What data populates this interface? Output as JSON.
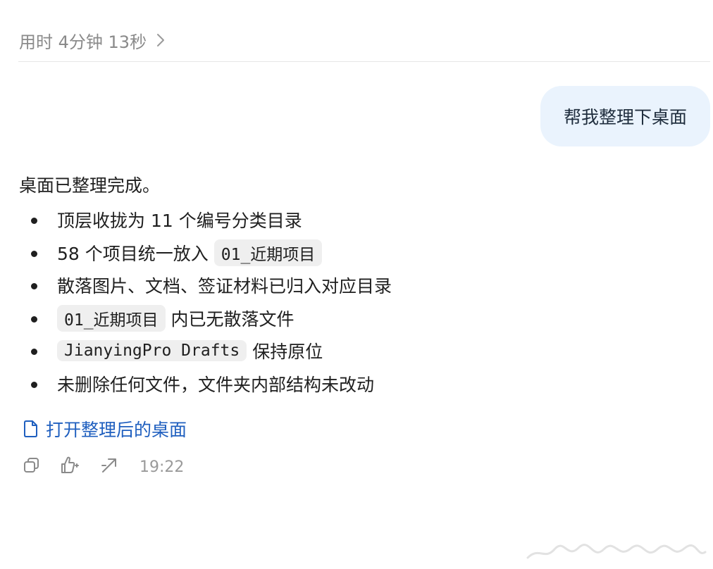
{
  "header": {
    "elapsed": "用时 4分钟 13秒"
  },
  "conversation": {
    "user_message": "帮我整理下桌面",
    "reply_title": "桌面已整理完成。",
    "bullets": {
      "b1": "顶层收拢为 11 个编号分类目录",
      "b2_text": "58 个项目统一放入",
      "b2_code": "01_近期项目",
      "b3": "散落图片、文档、签证材料已归入对应目录",
      "b4_code": "01_近期项目",
      "b4_text": "内已无散落文件",
      "b5_code": "JianyingPro Drafts",
      "b5_text": "保持原位",
      "b6": "未删除任何文件，文件夹内部结构未改动"
    },
    "open_link_label": "打开整理后的桌面",
    "timestamp": "19:22"
  },
  "icons": {
    "elapsed": "chevron-right-icon",
    "link": "document-icon",
    "actions": [
      "copy-icon",
      "thumbs-feedback-icon",
      "share-icon"
    ]
  },
  "colors": {
    "bubble_bg": "#eaf3fd",
    "link": "#1f5fbf",
    "muted": "#8a8a8a"
  }
}
